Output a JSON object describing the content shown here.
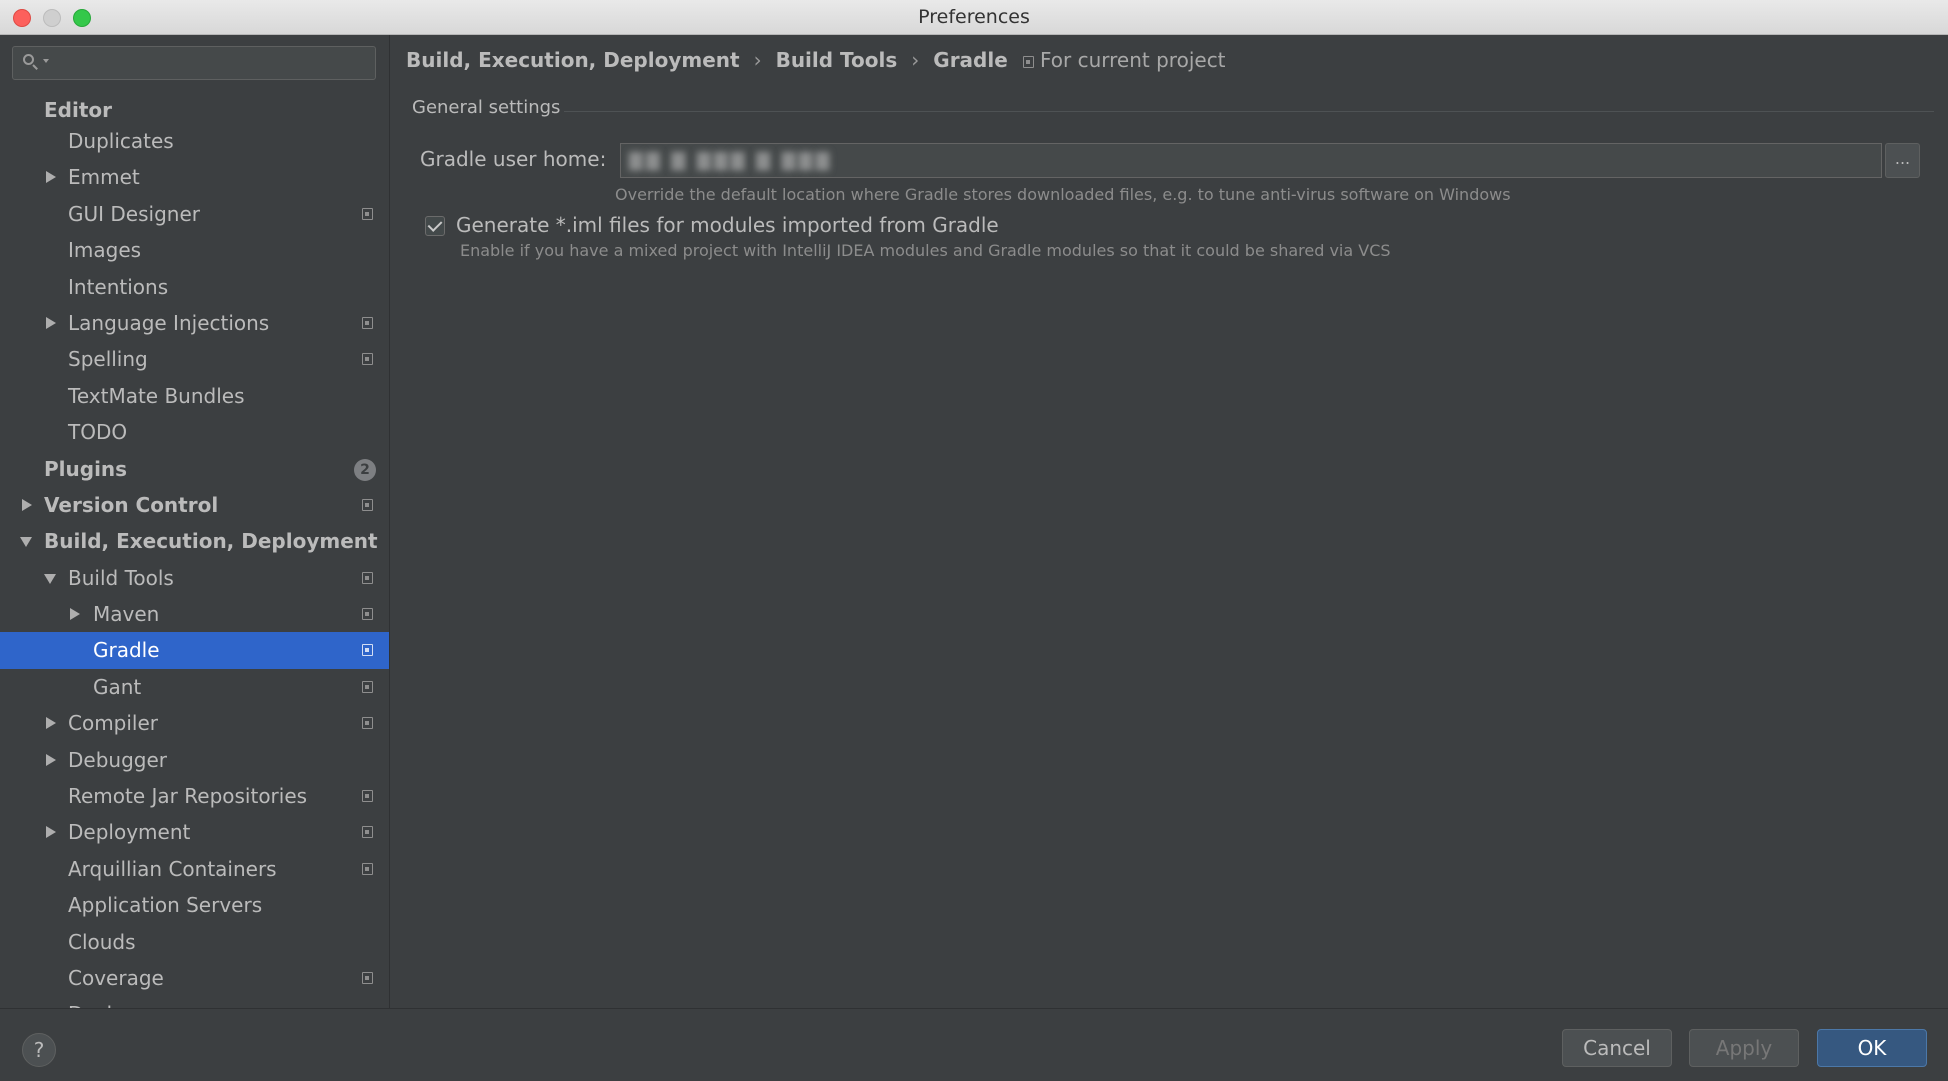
{
  "window": {
    "title": "Preferences"
  },
  "sidebar": {
    "search_placeholder": "",
    "items": [
      {
        "label": "Editor",
        "level": 0,
        "bold": true,
        "arrow": "none",
        "icon": false,
        "first": true
      },
      {
        "label": "Duplicates",
        "level": 1,
        "arrow": "none",
        "icon": false
      },
      {
        "label": "Emmet",
        "level": 1,
        "arrow": "right",
        "icon": false
      },
      {
        "label": "GUI Designer",
        "level": 1,
        "arrow": "none",
        "icon": true
      },
      {
        "label": "Images",
        "level": 1,
        "arrow": "none",
        "icon": false
      },
      {
        "label": "Intentions",
        "level": 1,
        "arrow": "none",
        "icon": false
      },
      {
        "label": "Language Injections",
        "level": 1,
        "arrow": "right",
        "icon": true
      },
      {
        "label": "Spelling",
        "level": 1,
        "arrow": "none",
        "icon": true
      },
      {
        "label": "TextMate Bundles",
        "level": 1,
        "arrow": "none",
        "icon": false
      },
      {
        "label": "TODO",
        "level": 1,
        "arrow": "none",
        "icon": false
      },
      {
        "label": "Plugins",
        "level": 0,
        "bold": true,
        "arrow": "none",
        "icon": false,
        "badge": "2"
      },
      {
        "label": "Version Control",
        "level": 0,
        "bold": true,
        "arrow": "right",
        "icon": true
      },
      {
        "label": "Build, Execution, Deployment",
        "level": 0,
        "bold": true,
        "arrow": "down",
        "icon": false
      },
      {
        "label": "Build Tools",
        "level": 1,
        "arrow": "down",
        "icon": true
      },
      {
        "label": "Maven",
        "level": 2,
        "arrow": "right",
        "icon": true
      },
      {
        "label": "Gradle",
        "level": 2,
        "arrow": "none",
        "icon": true,
        "selected": true
      },
      {
        "label": "Gant",
        "level": 2,
        "arrow": "none",
        "icon": true
      },
      {
        "label": "Compiler",
        "level": 1,
        "arrow": "right",
        "icon": true
      },
      {
        "label": "Debugger",
        "level": 1,
        "arrow": "right",
        "icon": false
      },
      {
        "label": "Remote Jar Repositories",
        "level": 1,
        "arrow": "none",
        "icon": true
      },
      {
        "label": "Deployment",
        "level": 1,
        "arrow": "right",
        "icon": true
      },
      {
        "label": "Arquillian Containers",
        "level": 1,
        "arrow": "none",
        "icon": true
      },
      {
        "label": "Application Servers",
        "level": 1,
        "arrow": "none",
        "icon": false
      },
      {
        "label": "Clouds",
        "level": 1,
        "arrow": "none",
        "icon": false
      },
      {
        "label": "Coverage",
        "level": 1,
        "arrow": "none",
        "icon": true
      },
      {
        "label": "Docker",
        "level": 1,
        "arrow": "right",
        "icon": false
      }
    ]
  },
  "main": {
    "breadcrumb": [
      "Build, Execution, Deployment",
      "Build Tools",
      "Gradle"
    ],
    "breadcrumb_sep": "›",
    "scope_label": "For current project",
    "section_title": "General settings",
    "gradle_home_label": "Gradle user home:",
    "gradle_home_value": "▇▇ ▇ ▇▇▇ ▇ ▇▇▇",
    "browse_label": "...",
    "gradle_home_hint": "Override the default location where Gradle stores downloaded files, e.g. to tune anti-virus software on Windows",
    "generate_iml_label": "Generate *.iml files for modules imported from Gradle",
    "generate_iml_checked": true,
    "generate_iml_hint": "Enable if you have a mixed project with IntelliJ IDEA modules and Gradle modules so that it could be shared via VCS"
  },
  "footer": {
    "help_label": "?",
    "cancel_label": "Cancel",
    "apply_label": "Apply",
    "ok_label": "OK"
  },
  "colors": {
    "background": "#3c3f41",
    "selection": "#2f65ca",
    "primary_button": "#365880"
  }
}
